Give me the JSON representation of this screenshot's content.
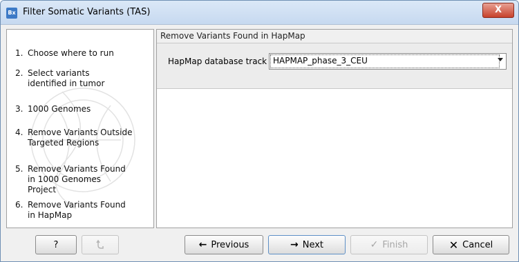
{
  "window": {
    "title": "Filter Somatic Variants (TAS)",
    "app_icon_text": "Bx",
    "close_label": "X"
  },
  "steps": [
    {
      "num": "1.",
      "label": "Choose where to run"
    },
    {
      "num": "2.",
      "label": "Select variants identified in tumor"
    },
    {
      "num": "3.",
      "label": "1000 Genomes"
    },
    {
      "num": "4.",
      "label": "Remove Variants Outside Targeted Regions"
    },
    {
      "num": "5.",
      "label": "Remove Variants Found in 1000 Genomes Project"
    },
    {
      "num": "6.",
      "label": "Remove Variants Found in HapMap"
    }
  ],
  "panel": {
    "title": "Remove Variants Found in HapMap",
    "field_label": "HapMap database track",
    "track_value": "HAPMAP_phase_3_CEU"
  },
  "buttons": {
    "help": "?",
    "previous": "Previous",
    "next": "Next",
    "finish": "Finish",
    "cancel": "Cancel"
  },
  "colors": {
    "title_bar": "#c6d9f0",
    "close_button": "#c7412b",
    "cancel_icon": "#000000"
  }
}
